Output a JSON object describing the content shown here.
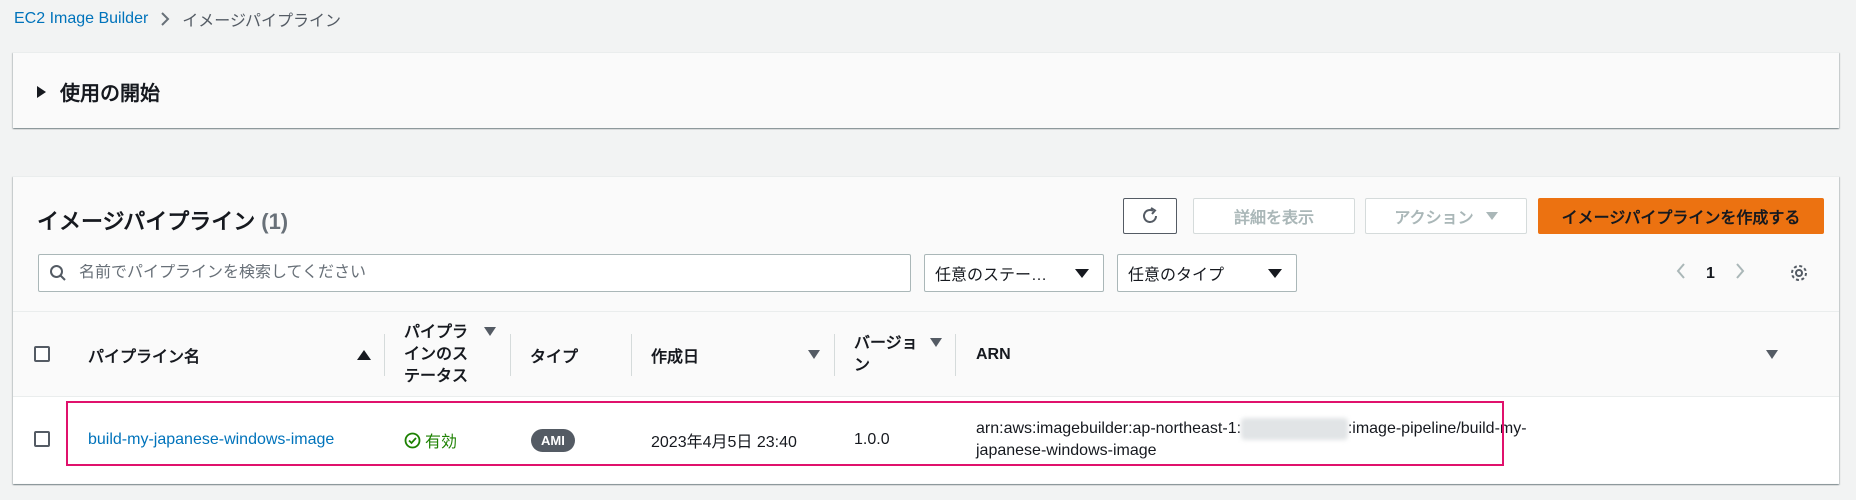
{
  "breadcrumb": {
    "root": "EC2 Image Builder",
    "current": "イメージパイプライン"
  },
  "getting_started": {
    "label": "使用の開始"
  },
  "table": {
    "title": "イメージパイプライン",
    "count": "(1)",
    "buttons": {
      "details": "詳細を表示",
      "actions": "アクション",
      "create": "イメージパイプラインを作成する"
    },
    "search_placeholder": "名前でパイプラインを検索してください",
    "filters": {
      "status": "任意のステー…",
      "type": "任意のタイプ"
    },
    "pagination": {
      "current_page": "1"
    },
    "columns": [
      "パイプライン名",
      "パイプラインのステータス",
      "タイプ",
      "作成日",
      "バージョン",
      "ARN"
    ],
    "columns_wrapped": {
      "status": [
        "パイプラ",
        "インのス",
        "テータス"
      ],
      "version": [
        "バージョ",
        "ン"
      ]
    },
    "rows": [
      {
        "name": "build-my-japanese-windows-image",
        "status": "有効",
        "type": "AMI",
        "created": "2023年4月5日 23:40",
        "version": "1.0.0",
        "arn_prefix": "arn:aws:imagebuilder:ap-northeast-1:",
        "arn_suffix": ":image-pipeline/build-my-",
        "arn_line2": "japanese-windows-image"
      }
    ]
  },
  "colors": {
    "link": "#0073bb",
    "primary": "#ec7211",
    "success": "#1d8102",
    "highlight": "#e0116c"
  }
}
